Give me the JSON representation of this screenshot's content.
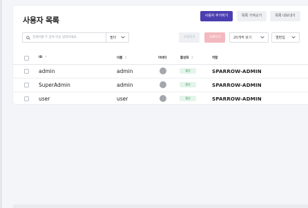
{
  "page": {
    "title": "사용자 목록"
  },
  "toolbar": {
    "add_user": "사용자 추가하기",
    "import_list": "목록 가져오기",
    "export_list": "목록 내보내기"
  },
  "filters": {
    "search_placeholder": "검색어를 두 글자 이상 입력하세요.",
    "filter_label": "필터",
    "edit_label": "수정하기",
    "delete_label": "삭제하기",
    "page_size": "20개씩 보기",
    "columns_label": "열편집"
  },
  "table": {
    "headers": {
      "id": "ID",
      "id_sort": "↑",
      "name": "이름",
      "name_sort": "↕",
      "avatar": "아바타",
      "active": "활성화",
      "active_sort": "↕",
      "role": "역할"
    },
    "rows": [
      {
        "id": "admin",
        "name": "admin",
        "status": "활성",
        "role": "SPARROW-ADMIN"
      },
      {
        "id": "SuperAdmin",
        "name": "admin",
        "status": "활성",
        "role": "SPARROW-ADMIN"
      },
      {
        "id": "user",
        "name": "user",
        "status": "활성",
        "role": "SPARROW-ADMIN"
      }
    ]
  },
  "colors": {
    "primary": "#4b3eb0",
    "delete_disabled": "#f3b9bf",
    "active_badge_bg": "#e4f4ea",
    "active_badge_text": "#3f9a66",
    "avatar": "#a3a6ad"
  },
  "icons": {
    "search": "search-icon",
    "chevron": "chevron-down-icon"
  }
}
